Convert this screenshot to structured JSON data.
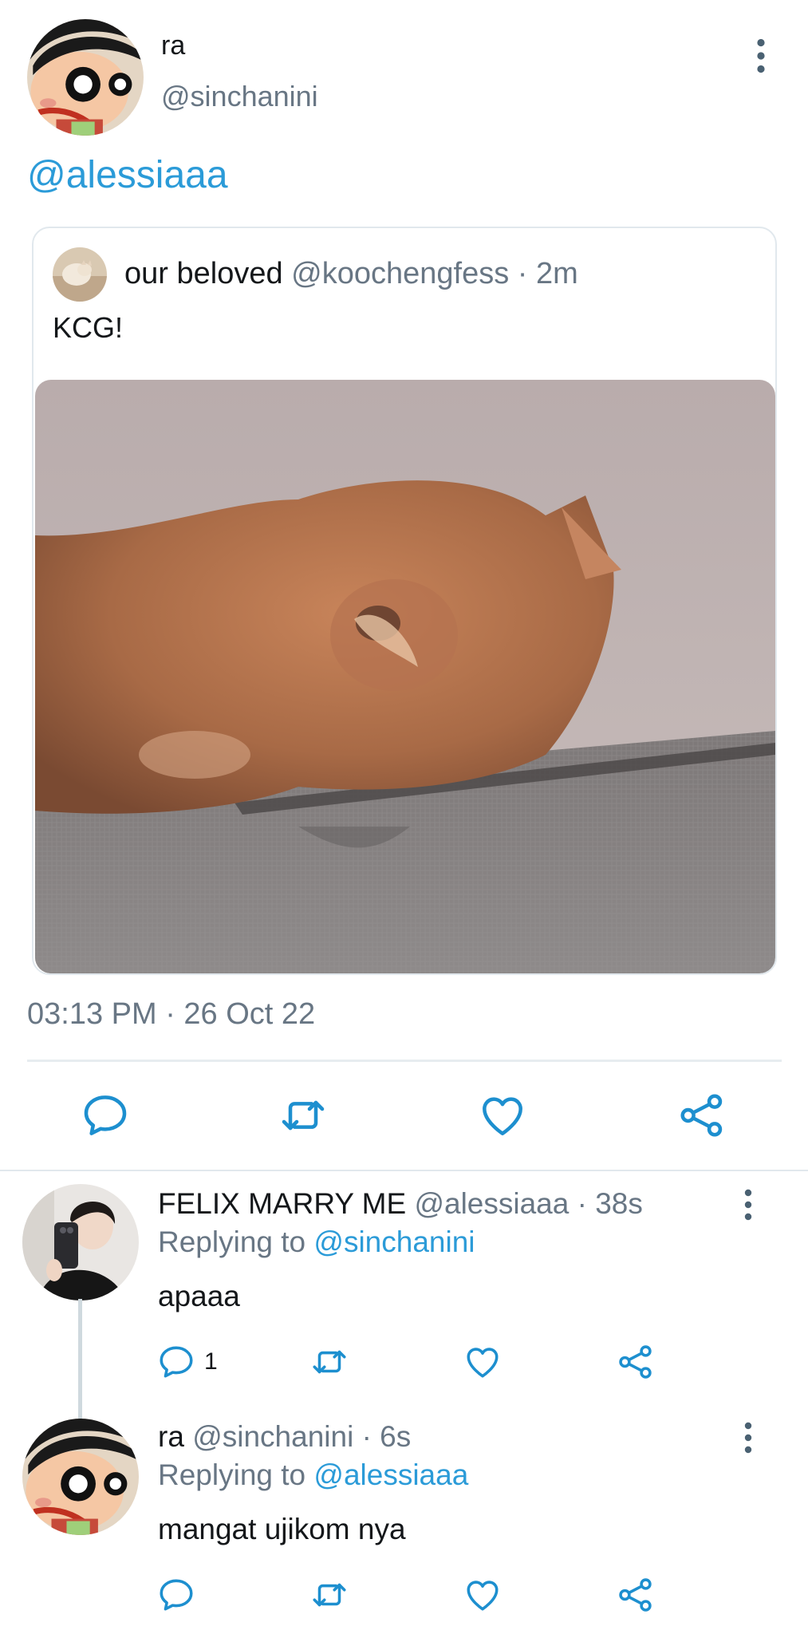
{
  "main_tweet": {
    "display_name": "ra",
    "handle": "@sinchanini",
    "text": "@alessiaaa",
    "timestamp": "03:13 PM · 26 Oct 22",
    "avatar_icon": "shinchan-avatar-icon"
  },
  "quoted_tweet": {
    "display_name": "our beloved",
    "handle": "@koochengfess",
    "time": "· 2m",
    "text": "KCG!",
    "photo": "cat-photo"
  },
  "replies": [
    {
      "display_name": "FELIX MARRY ME",
      "handle": "@alessiaaa",
      "time": "· 38s",
      "replying_prefix": "Replying to",
      "replying_to": "@sinchanini",
      "text": "apaaa",
      "reply_count": "1"
    },
    {
      "display_name": "ra",
      "handle": "@sinchanini",
      "time": "· 6s",
      "replying_prefix": "Replying to",
      "replying_to": "@alessiaaa",
      "text": "mangat ujikom nya",
      "reply_count": ""
    }
  ],
  "colors": {
    "link": "#2b9bd8",
    "muted": "#687684",
    "icon": "#1d8fcf",
    "divider": "#e1e8ed"
  }
}
